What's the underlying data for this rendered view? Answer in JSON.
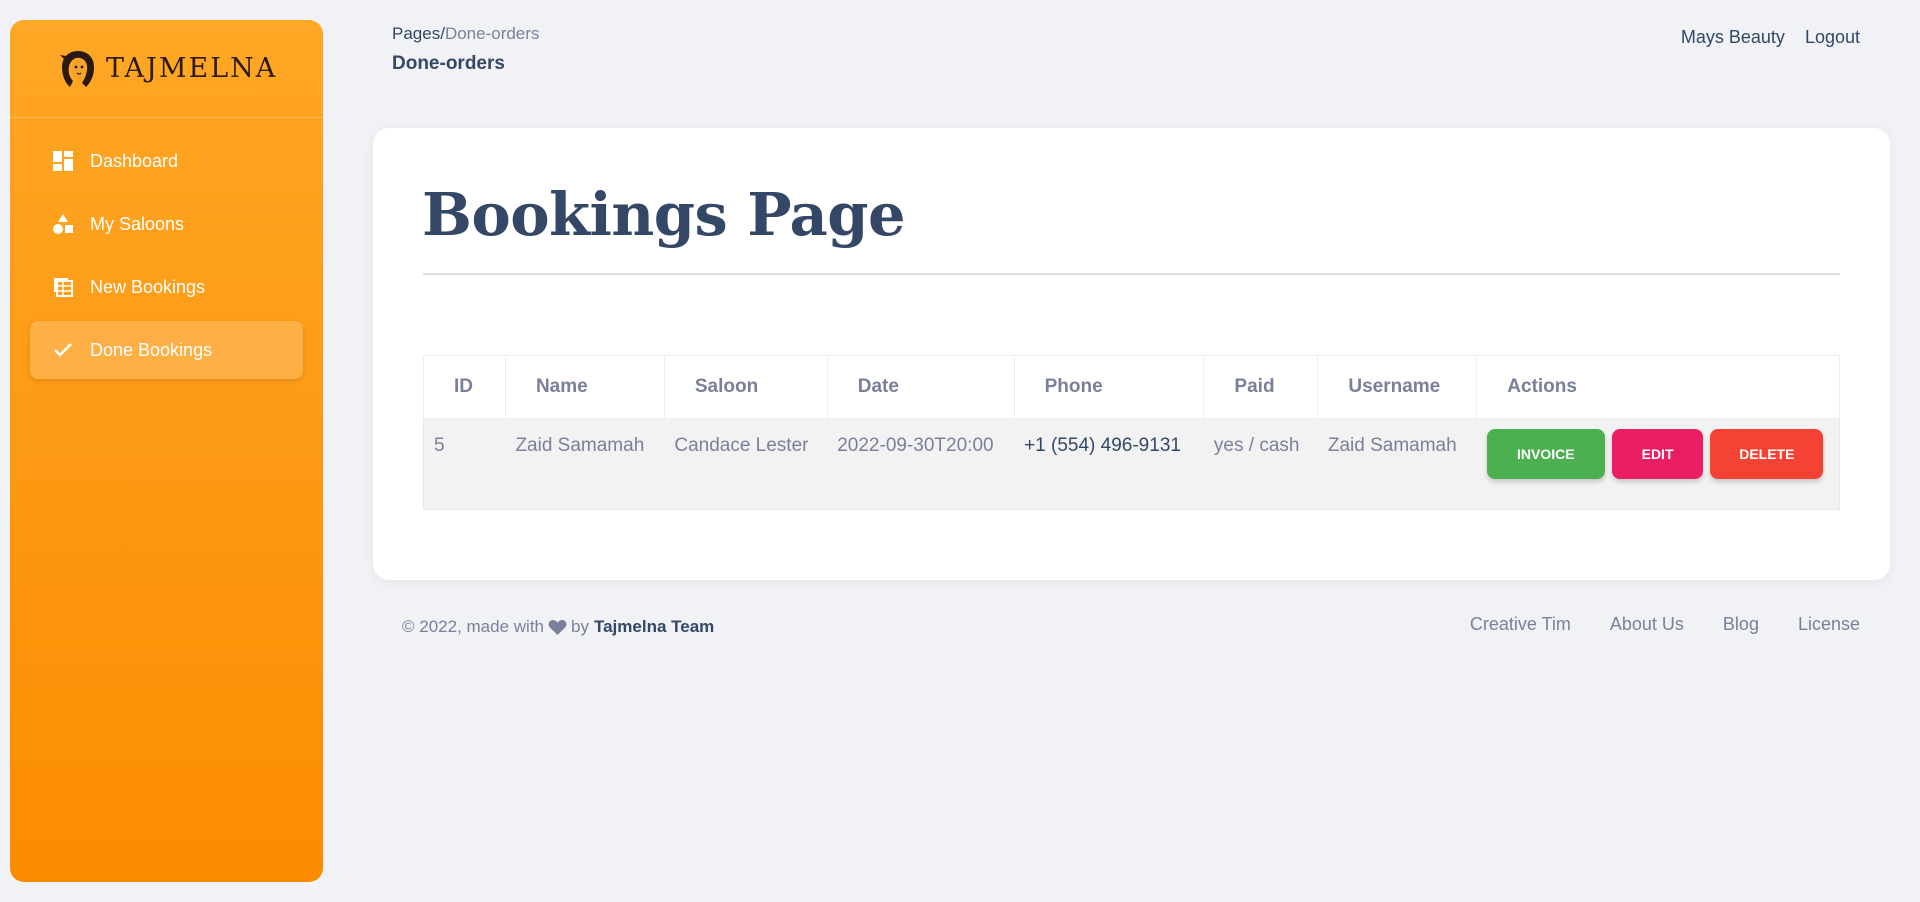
{
  "brand": {
    "name": "TAJMELNA",
    "logo_icon": "woman-face-logo"
  },
  "sidebar": {
    "items": [
      {
        "label": "Dashboard",
        "icon": "dashboard-icon",
        "active": false
      },
      {
        "label": "My Saloons",
        "icon": "shapes-icon",
        "active": false
      },
      {
        "label": "New Bookings",
        "icon": "table-view-icon",
        "active": false
      },
      {
        "label": "Done Bookings",
        "icon": "check-icon",
        "active": true
      }
    ]
  },
  "header": {
    "breadcrumb_root": "Pages",
    "breadcrumb_sep": "/",
    "breadcrumb_current": "Done-orders",
    "page_title": "Done-orders",
    "user_name": "Mays Beauty",
    "logout_label": "Logout"
  },
  "main": {
    "title": "Bookings Page",
    "table": {
      "columns": [
        "ID",
        "Name",
        "Saloon",
        "Date",
        "Phone",
        "Paid",
        "Username",
        "Actions"
      ],
      "rows": [
        {
          "id": "5",
          "name": "Zaid Samamah",
          "saloon": "Candace Lester",
          "date": "2022-09-30T20:00",
          "phone": "+1 (554) 496-9131",
          "paid": "yes / cash",
          "username": "Zaid Samamah",
          "actions": {
            "invoice": "INVOICE",
            "edit": "EDIT",
            "delete": "DELETE"
          }
        }
      ]
    }
  },
  "footer": {
    "copyright": "© 2022, made with",
    "by": "by",
    "team": "Tajmelna Team",
    "links": [
      "Creative Tim",
      "About Us",
      "Blog",
      "License"
    ]
  },
  "colors": {
    "sidebar_start": "#ffa726",
    "sidebar_end": "#fb8c00",
    "invoice": "#4caf50",
    "edit": "#e91e63",
    "delete": "#f44335",
    "text_dark": "#344767",
    "text_muted": "#7b809a"
  }
}
